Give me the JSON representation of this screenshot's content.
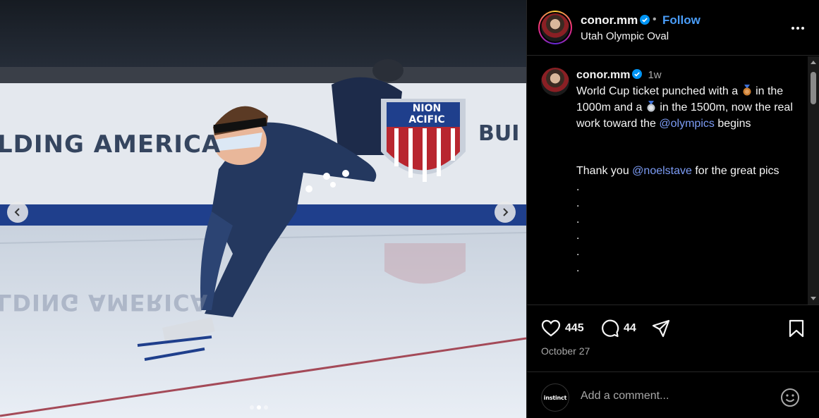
{
  "post": {
    "username": "conor.mm",
    "separator": "•",
    "follow_label": "Follow",
    "location": "Utah Olympic Oval"
  },
  "caption": {
    "username": "conor.mm",
    "time": "1w",
    "text_1": "World Cup ticket punched with a",
    "text_2": "in the 1000m and a",
    "text_3": "in the 1500m, now the real work toward the",
    "mention_1": "@olympics",
    "text_4": "begins",
    "text_5": "Thank you",
    "mention_2": "@noelstave",
    "text_6": "for the great pics",
    "dot": "."
  },
  "media": {
    "banner_left": "LDING AMERICA",
    "banner_right": "BUI",
    "shield_text_1": "NION",
    "shield_text_2": "ACIFIC",
    "reflection": "LDING AMERICA",
    "slide_count": 3,
    "active_slide": 1
  },
  "actions": {
    "likes": "445",
    "comments": "44",
    "date": "October 27"
  },
  "add_comment": {
    "avatar_text": "instinct",
    "placeholder": "Add a comment..."
  },
  "colors": {
    "accent": "#4a9df8",
    "mention": "#7c9cf5",
    "muted": "#a8a8a8",
    "background": "#000000"
  },
  "icons": [
    "chevron-left-icon",
    "chevron-right-icon",
    "verified-icon",
    "more-icon",
    "bronze-medal-icon",
    "silver-medal-icon",
    "heart-icon",
    "comment-icon",
    "share-icon",
    "bookmark-icon",
    "emoji-icon"
  ]
}
